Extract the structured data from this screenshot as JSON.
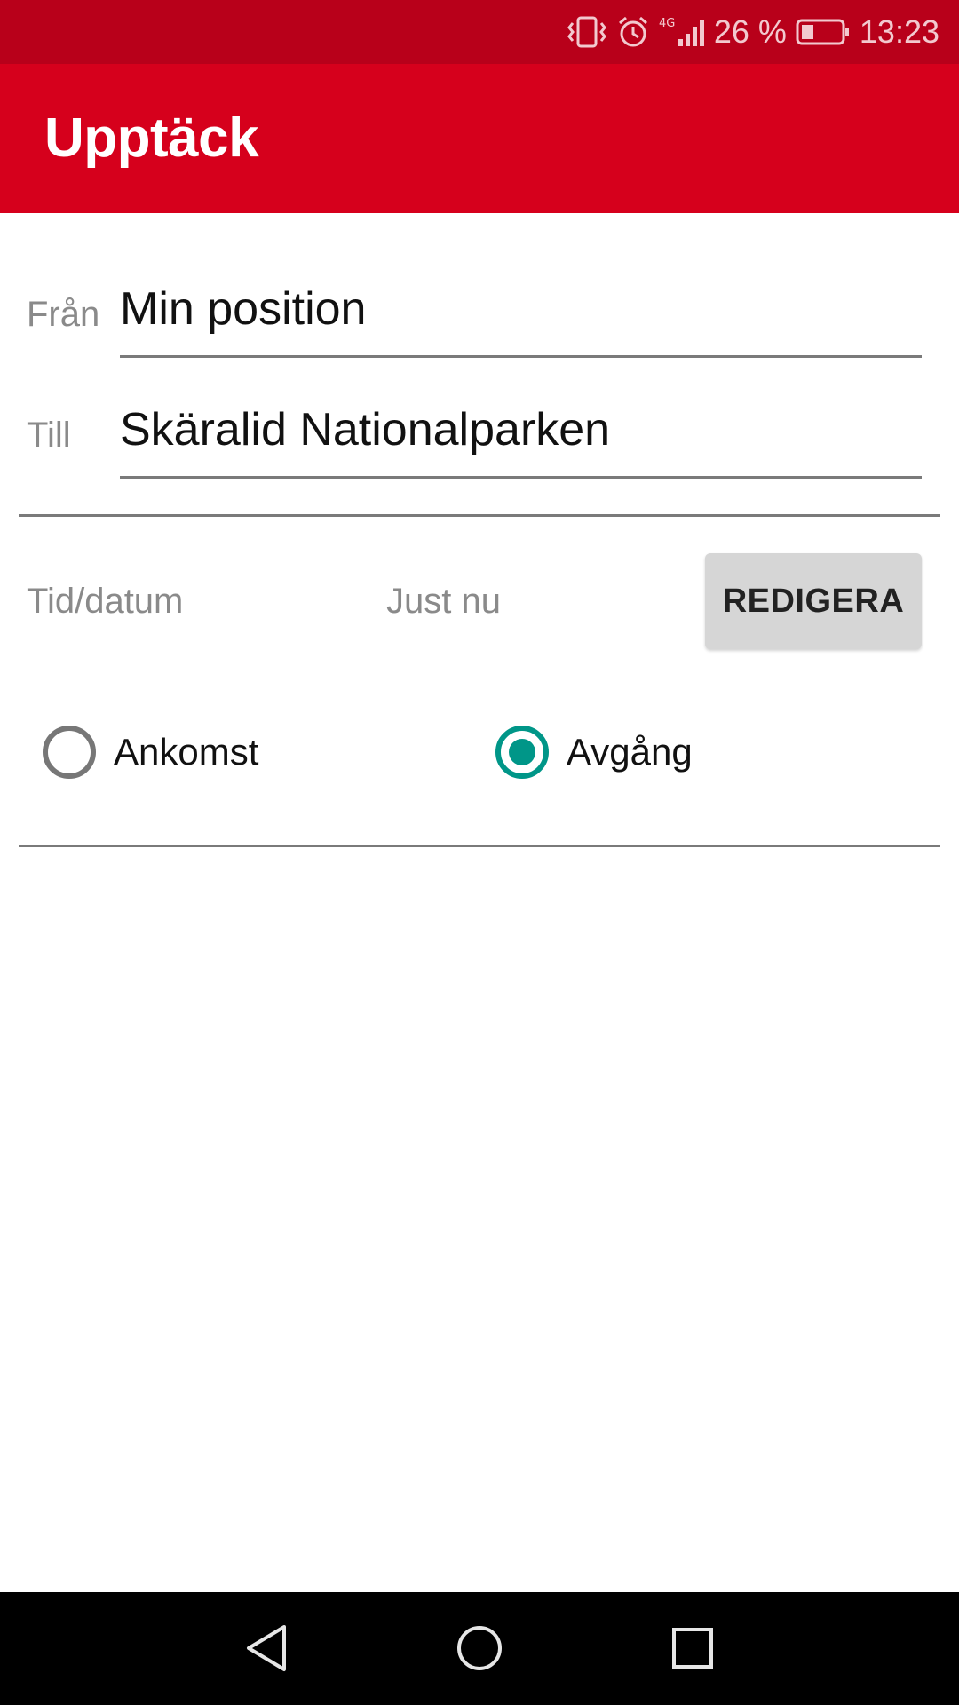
{
  "status_bar": {
    "battery_percent": "26 %",
    "time": "13:23",
    "network": "4G",
    "icons": [
      "vibrate-icon",
      "alarm-icon",
      "signal-icon",
      "battery-icon"
    ]
  },
  "app_bar": {
    "title": "Upptäck",
    "color": "#d6001c"
  },
  "trip_form": {
    "from": {
      "label": "Från",
      "value": "Min position"
    },
    "to": {
      "label": "Till",
      "value": "Skäralid Nationalparken"
    }
  },
  "time_section": {
    "label": "Tid/datum",
    "value": "Just nu",
    "edit_button_label": "REDIGERA"
  },
  "direction": {
    "options": [
      {
        "label": "Ankomst",
        "checked": false
      },
      {
        "label": "Avgång",
        "checked": true
      }
    ],
    "accent_color": "#009688"
  },
  "nav_bar": {
    "icons": [
      "back-icon",
      "home-icon",
      "recents-icon"
    ]
  }
}
